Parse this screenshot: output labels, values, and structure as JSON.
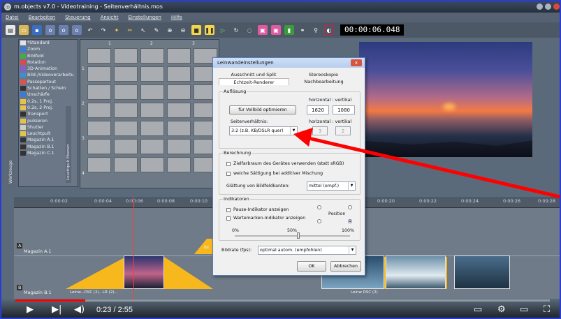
{
  "window": {
    "title": "m.objects v7.0 - Videotraining - Seitenverhältnis.mos"
  },
  "menu": [
    "Datei",
    "Bearbeiten",
    "Steuerung",
    "Ansicht",
    "Einstellungen",
    "Hilfe"
  ],
  "timecode": "00:00:06.048",
  "tool_list": [
    "*Standard",
    "Zoom",
    "Bildfeld",
    "Rotation",
    "3D-Animation",
    "Bild-/Videoverarbeitu",
    "Passepartout",
    "Schatten / Schein",
    "Unschärfe",
    "0.2s, 1 Proj.",
    "0.2s, 2 Proj.",
    "Transport",
    "pulsieren",
    "Shutter",
    "Leuchtpult",
    "Magazin A.1",
    "Magazin B.1",
    "Magazin C.1"
  ],
  "tool_vertical_label": "Werkzeuge",
  "grid_side_label": "Leuchtpult Ebenen",
  "grid": {
    "columns": [
      "1",
      "2",
      "3"
    ],
    "rows": [
      "1",
      "2",
      "3",
      "4"
    ]
  },
  "ruler_ticks": [
    "0:00:02",
    "0:00:04",
    "0:00:06",
    "0:00:08",
    "0:00:10",
    "0:00:20",
    "0:00:22",
    "0:00:24",
    "0:00:26",
    "0:00:28"
  ],
  "tracks": {
    "a": "Magazin A.1",
    "b": "Magazin B.1",
    "a_marker": "A",
    "b_marker": "B"
  },
  "clips": {
    "left_label": "Leinw...DSC (2)...LR (2)...",
    "right_label": "Leinw DSC (2)",
    "clip_right_label": "Bil"
  },
  "dialog": {
    "title": "Leinwandeinstellungen",
    "close": "x",
    "tabs_row1": [
      "Ausschnitt und Split",
      "Stereoskopie"
    ],
    "tabs_row2": [
      "Echtzeit-Renderer",
      "Nachbearbeitung"
    ],
    "aufloesung": {
      "legend": "Auflösung",
      "hv_label": "horizontal : vertikal",
      "button": "für Vollbild optimieren",
      "h": "1620",
      "v": "1080",
      "seitenverh_label": "Seitenverhältnis:",
      "seitenverh_hv": "horizontal : vertikal",
      "combo_value": "3:2 (z.B. KB/DSLR quer)",
      "ratio_h": "3",
      "ratio_v": "2"
    },
    "berechnung": {
      "legend": "Berechnung",
      "check1": "Zielfarbraum des Gerätes verwenden (statt sRGB)",
      "check2": "weiche Sättigung bei additiver Mischung",
      "glaettung_label": "Glättung von Bildfeldkanten:",
      "glaettung_value": "mittel (empf.)"
    },
    "indikatoren": {
      "legend": "Indikatoren",
      "check1": "Pause-Indikator anzeigen",
      "check2": "Wartemarken-Indikator anzeigen",
      "position": "Position",
      "slider_min": "0%",
      "slider_mid": "50%",
      "slider_max": "100%",
      "slider_value": 0.55
    },
    "bildrate_label": "Bildrate (fps):",
    "bildrate_value": "optimal autom. (empfohlen)",
    "ok": "OK",
    "cancel": "Abbrechen"
  },
  "player": {
    "time": "0:23 / 2:55",
    "progress": 0.131
  },
  "colors": {
    "accent_red": "#ff0000",
    "clip_gold": "#f6b81c",
    "dialog_border": "#5c7fb7"
  }
}
